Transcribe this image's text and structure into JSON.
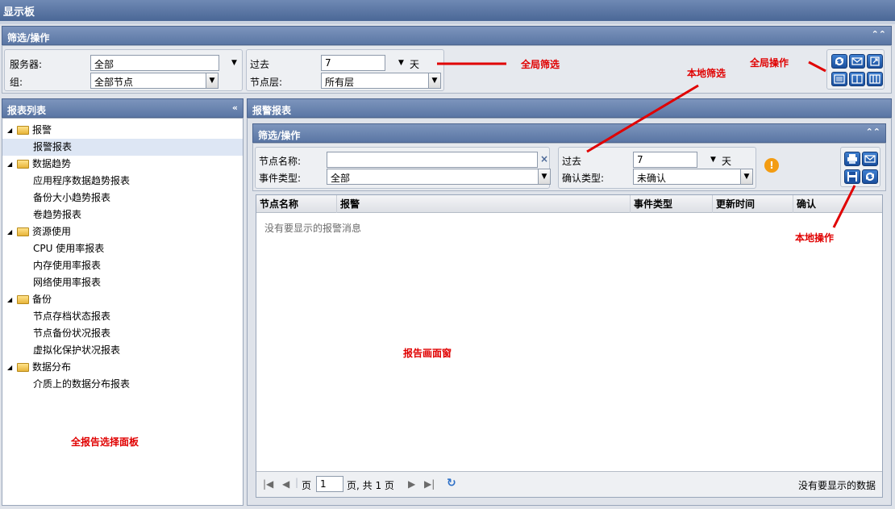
{
  "window": {
    "title": "显示板"
  },
  "global_filter": {
    "header": "筛选/操作",
    "server_label": "服务器:",
    "server_value": "全部",
    "group_label": "组:",
    "group_value": "全部节点",
    "past_label": "过去",
    "past_value": "7",
    "past_unit": "天",
    "node_layer_label": "节点层:",
    "node_layer_value": "所有层"
  },
  "report_list": {
    "header": "报表列表",
    "items": [
      {
        "type": "folder",
        "label": "报警"
      },
      {
        "type": "leaf",
        "label": "报警报表",
        "selected": true
      },
      {
        "type": "folder",
        "label": "数据趋势"
      },
      {
        "type": "leaf",
        "label": "应用程序数据趋势报表"
      },
      {
        "type": "leaf",
        "label": "备份大小趋势报表"
      },
      {
        "type": "leaf",
        "label": "卷趋势报表"
      },
      {
        "type": "folder",
        "label": "资源使用"
      },
      {
        "type": "leaf",
        "label": "CPU 使用率报表"
      },
      {
        "type": "leaf",
        "label": "内存使用率报表"
      },
      {
        "type": "leaf",
        "label": "网络使用率报表"
      },
      {
        "type": "folder",
        "label": "备份"
      },
      {
        "type": "leaf",
        "label": "节点存档状态报表"
      },
      {
        "type": "leaf",
        "label": "节点备份状况报表"
      },
      {
        "type": "leaf",
        "label": "虚拟化保护状况报表"
      },
      {
        "type": "folder",
        "label": "数据分布"
      },
      {
        "type": "leaf",
        "label": "介质上的数据分布报表"
      }
    ]
  },
  "report_view": {
    "header": "报警报表",
    "filter_header": "筛选/操作",
    "node_name_label": "节点名称:",
    "node_name_value": "",
    "event_type_label": "事件类型:",
    "event_type_value": "全部",
    "past_label": "过去",
    "past_value": "7",
    "past_unit": "天",
    "confirm_type_label": "确认类型:",
    "confirm_type_value": "未确认",
    "columns": [
      "节点名称",
      "报警",
      "事件类型",
      "更新时间",
      "确认"
    ],
    "empty_message": "没有要显示的报警消息",
    "pager": {
      "page_label": "页",
      "page_value": "1",
      "page_total": "页, 共 1 页",
      "status": "没有要显示的数据"
    }
  },
  "annotations": {
    "global_filter": "全局筛选",
    "global_ops": "全局操作",
    "local_filter": "本地筛选",
    "local_ops": "本地操作",
    "report_pane": "报告画面窗",
    "report_select_panel": "全报告选择面板"
  },
  "icons": {
    "folder": "folder-icon",
    "refresh": "refresh-icon",
    "email": "email-icon",
    "export": "export-icon",
    "print": "print-icon",
    "save": "save-icon",
    "warning": "warning-icon"
  },
  "colors": {
    "header_blue": "#5a76a4",
    "annotation_red": "#e00000",
    "selection": "#dde6f4",
    "warning_orange": "#f39c12"
  }
}
